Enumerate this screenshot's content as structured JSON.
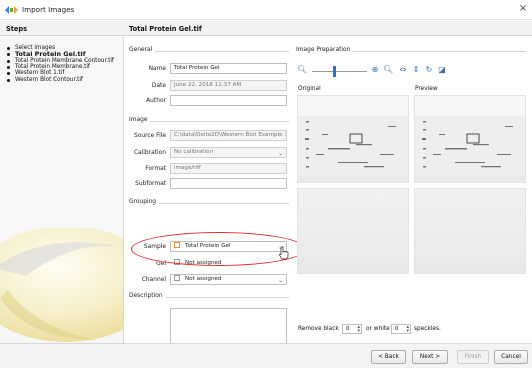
{
  "window": {
    "title": "Import Images",
    "close_glyph": "×",
    "icon": "app-icon"
  },
  "header": {
    "steps_title": "Steps",
    "file_title": "Total Protein Gel.tif"
  },
  "steps": [
    {
      "label": "Select images",
      "current": false
    },
    {
      "label": "Total Protein Gel.tif",
      "current": true
    },
    {
      "label": "Total Protein Membrane Contour.tif",
      "current": false
    },
    {
      "label": "Total Protein Membrane.tif",
      "current": false
    },
    {
      "label": "Western Blot 1.tif",
      "current": false
    },
    {
      "label": "Western Blot Contour.tif",
      "current": false
    }
  ],
  "general": {
    "section": "General",
    "name_label": "Name",
    "name_value": "Total Protein Gel",
    "date_label": "Date",
    "date_value": "June 22, 2018 11:37 AM",
    "author_label": "Author",
    "author_value": ""
  },
  "image": {
    "section": "Image",
    "source_label": "Source File",
    "source_value": "C:\\data\\Delta2D\\Western Blot Example 1",
    "calibration_label": "Calibration",
    "calibration_value": "No calibration",
    "format_label": "Format",
    "format_value": "image/tiff",
    "subformat_label": "Subformat",
    "subformat_value": ""
  },
  "grouping": {
    "section": "Grouping",
    "sample_label": "Sample",
    "sample_value": "Total Protein Gel",
    "sample_color": "#e89230",
    "gel_label": "Gel",
    "gel_value": "Not assigned",
    "channel_label": "Channel",
    "channel_value": "Not assigned"
  },
  "description": {
    "section": "Description",
    "value": ""
  },
  "image_prep": {
    "section": "Image Preparation",
    "zoom_level": 0.4,
    "original_label": "Original",
    "preview_label": "Preview",
    "remove_black_label": "Remove black",
    "remove_black_value": "0",
    "or_white_label": "or white",
    "white_value": "0",
    "speckles_label": "speckles."
  },
  "buttons": {
    "back": "< Back",
    "next": "Next >",
    "finish": "Finish",
    "cancel": "Cancel"
  },
  "colors": {
    "accent": "#2f6fd1",
    "highlight": "#d8302f"
  }
}
